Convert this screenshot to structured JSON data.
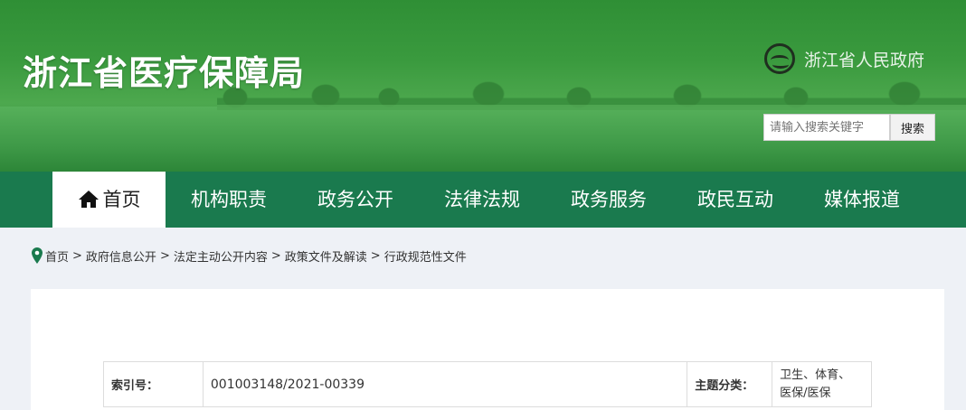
{
  "header": {
    "site_title": "浙江省医疗保障局",
    "gov_link": "浙江省人民政府",
    "search_placeholder": "请输入搜索关键字",
    "search_button": "搜索"
  },
  "nav": {
    "items": [
      {
        "label": "首页",
        "icon": "home-icon",
        "active": true
      },
      {
        "label": "机构职责"
      },
      {
        "label": "政务公开"
      },
      {
        "label": "法律法规"
      },
      {
        "label": "政务服务"
      },
      {
        "label": "政民互动"
      },
      {
        "label": "媒体报道"
      }
    ]
  },
  "breadcrumb": {
    "icon": "location-pin-icon",
    "items": [
      "首页",
      "政府信息公开",
      "法定主动公开内容",
      "政策文件及解读",
      "行政规范性文件"
    ],
    "separator": ">"
  },
  "info": {
    "index_label": "索引号：",
    "index_value": "001003148/2021-00339",
    "topic_label": "主题分类：",
    "topic_value_line1": "卫生、体育、",
    "topic_value_line2": "医保/医保"
  },
  "colors": {
    "banner_green": "#3a9a3e",
    "nav_green": "#1a7a4e",
    "page_bg": "#eef1f6"
  }
}
